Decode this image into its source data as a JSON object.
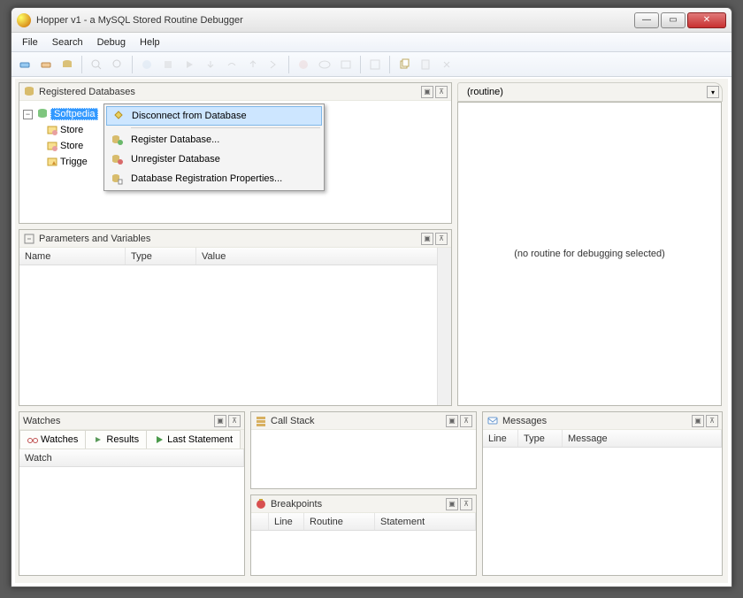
{
  "window": {
    "title": "Hopper v1 - a MySQL Stored Routine Debugger"
  },
  "menu": {
    "file": "File",
    "search": "Search",
    "debug": "Debug",
    "help": "Help"
  },
  "panels": {
    "registered_db": {
      "title": "Registered Databases"
    },
    "params": {
      "title": "Parameters and Variables",
      "cols": {
        "name": "Name",
        "type": "Type",
        "value": "Value"
      }
    },
    "watches": {
      "title": "Watches",
      "tabs": {
        "watches": "Watches",
        "results": "Results",
        "last": "Last Statement"
      },
      "col": "Watch"
    },
    "callstack": {
      "title": "Call Stack"
    },
    "breakpoints": {
      "title": "Breakpoints",
      "cols": {
        "line": "Line",
        "routine": "Routine",
        "statement": "Statement"
      }
    },
    "messages": {
      "title": "Messages",
      "cols": {
        "line": "Line",
        "type": "Type",
        "message": "Message"
      }
    }
  },
  "tree": {
    "root": "Softpedia",
    "children": {
      "c1": "Store",
      "c2": "Store",
      "c3": "Trigge"
    }
  },
  "routine": {
    "tab": "(routine)",
    "empty": "(no routine for debugging selected)"
  },
  "contextmenu": {
    "disconnect": "Disconnect from Database",
    "register": "Register Database...",
    "unregister": "Unregister Database",
    "props": "Database Registration Properties..."
  }
}
